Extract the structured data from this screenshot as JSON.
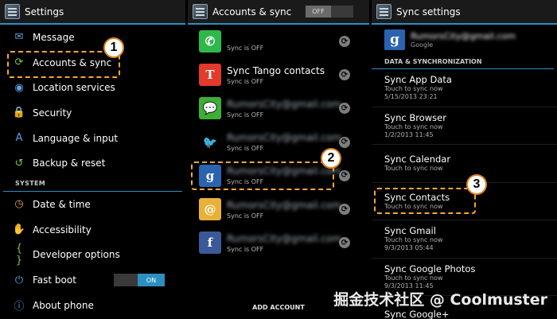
{
  "settings": {
    "title": "Settings",
    "items_top": [
      {
        "label": "Message",
        "icon": "envelope-icon",
        "glyph": "✉",
        "color": "#5ba3e0"
      },
      {
        "label": "Accounts & sync",
        "icon": "sync-icon",
        "glyph": "⟳",
        "color": "#7fc43f"
      },
      {
        "label": "Location services",
        "icon": "location-icon",
        "glyph": "◉",
        "color": "#5ba3e0"
      },
      {
        "label": "Security",
        "icon": "lock-icon",
        "glyph": "🔒",
        "color": "#e5a23a"
      },
      {
        "label": "Language & input",
        "icon": "keyboard-icon",
        "glyph": "A",
        "color": "#5ba3e0"
      },
      {
        "label": "Backup & reset",
        "icon": "backup-icon",
        "glyph": "↺",
        "color": "#7fc43f"
      }
    ],
    "system_header": "SYSTEM",
    "items_system": [
      {
        "label": "Date & time",
        "icon": "clock-icon",
        "glyph": "◷",
        "color": "#e5a23a"
      },
      {
        "label": "Accessibility",
        "icon": "hand-icon",
        "glyph": "✋",
        "color": "#5ba3e0"
      },
      {
        "label": "Developer options",
        "icon": "braces-icon",
        "glyph": "{ }",
        "color": "#7fc43f"
      },
      {
        "label": "Fast boot",
        "icon": "power-icon",
        "glyph": "⏻",
        "color": "#5ba3e0",
        "toggle": "ON"
      },
      {
        "label": "About phone",
        "icon": "info-icon",
        "glyph": "ⓘ",
        "color": "#5ba3e0"
      }
    ]
  },
  "accounts_sync": {
    "title": "Accounts & sync",
    "master_toggle": "OFF",
    "accounts": [
      {
        "title": "",
        "sub": "Sync is OFF",
        "icon": "whatsapp-icon",
        "glyph": "✆",
        "bg": "#2fb84a",
        "blur": false
      },
      {
        "title": "Sync Tango contacts",
        "sub": "Sync is OFF",
        "icon": "tango-icon",
        "glyph": "T",
        "bg": "#e23b2b",
        "blur": false
      },
      {
        "title": "RumorsCity@gmail.com",
        "sub": "Sync is OFF",
        "icon": "wechat-icon",
        "glyph": "💬",
        "bg": "#3cb035",
        "blur": true
      },
      {
        "title": "RumorsCity@gmail.com",
        "sub": "Sync is OFF",
        "icon": "twitter-icon",
        "glyph": "🐦",
        "bg": "#000000",
        "blur": true
      },
      {
        "title": "RumorsCity@gmail.com",
        "sub": "Sync is OFF",
        "icon": "google-icon",
        "glyph": "g",
        "bg": "#2a64b0",
        "blur": true
      },
      {
        "title": "RumorsCity@gmail.com",
        "sub": "Sync is OFF",
        "icon": "email-icon",
        "glyph": "@",
        "bg": "#e8b23a",
        "blur": true
      },
      {
        "title": "RumorsCity@gmail.com",
        "sub": "Sync is OFF",
        "icon": "facebook-icon",
        "glyph": "f",
        "bg": "#3b5998",
        "blur": true
      }
    ],
    "add_account": "ADD ACCOUNT"
  },
  "sync_settings": {
    "title": "Sync settings",
    "account_email": "RumorsCity@gmail.com",
    "account_type": "Google",
    "section_header": "DATA & SYNCHRONIZATION",
    "items": [
      {
        "title": "Sync App Data",
        "sub1": "Touch to sync now",
        "sub2": "5/15/2013 23:21"
      },
      {
        "title": "Sync Browser",
        "sub1": "Touch to sync now",
        "sub2": "1/2/2013 11:45"
      },
      {
        "title": "Sync Calendar",
        "sub1": "Touch to sync now",
        "sub2": ""
      },
      {
        "title": "Sync Contacts",
        "sub1": "Touch to sync now",
        "sub2": ""
      },
      {
        "title": "Sync Gmail",
        "sub1": "Touch to sync now",
        "sub2": "9/3/2013 05:44"
      },
      {
        "title": "Sync Google Photos",
        "sub1": "Touch to sync now",
        "sub2": "9/3/2013 11:45"
      },
      {
        "title": "Sync Google+",
        "sub1": "",
        "sub2": ""
      }
    ]
  },
  "annotations": {
    "step1": "1",
    "step2": "2",
    "step3": "3"
  },
  "watermark": "掘金技术社区 @ Coolmuster"
}
